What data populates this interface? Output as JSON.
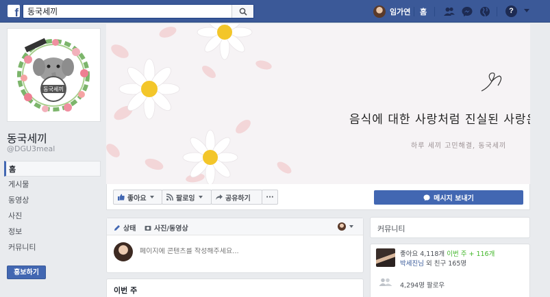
{
  "search": {
    "value": "동국세끼"
  },
  "header": {
    "user_name": "임가연",
    "home_label": "홈",
    "help_label": "?"
  },
  "page": {
    "name": "동국세끼",
    "handle": "@DGU3meal"
  },
  "nav": [
    {
      "label": "홈",
      "active": true
    },
    {
      "label": "게시물"
    },
    {
      "label": "동영상"
    },
    {
      "label": "사진"
    },
    {
      "label": "정보"
    },
    {
      "label": "커뮤니티"
    }
  ],
  "promote_label": "홍보하기",
  "cover": {
    "title": "음식에 대한 사랑처럼 진실된 사랑은 없다",
    "subtitle": "하루 세끼 고민해결, 동국세끼"
  },
  "actions": {
    "like": "좋아요",
    "follow": "팔로잉",
    "share": "공유하기",
    "more": "···",
    "message": "메시지 보내기"
  },
  "composer": {
    "tab_status": "상태",
    "tab_photo": "사진/동영상",
    "placeholder": "페이지에 콘텐츠를 작성해주세요..."
  },
  "this_week": "이번 주",
  "community": {
    "title": "커뮤니티",
    "likes_prefix": "좋아요 4,118개 ",
    "likes_week": "이번 주 + 116개",
    "friend_name": "박세진님",
    "friend_suffix": " 외 친구 165명",
    "followers": "4,294명 팔로우"
  },
  "colors": {
    "brand": "#3b5998",
    "button_blue": "#4267b2",
    "green": "#42b72a"
  }
}
